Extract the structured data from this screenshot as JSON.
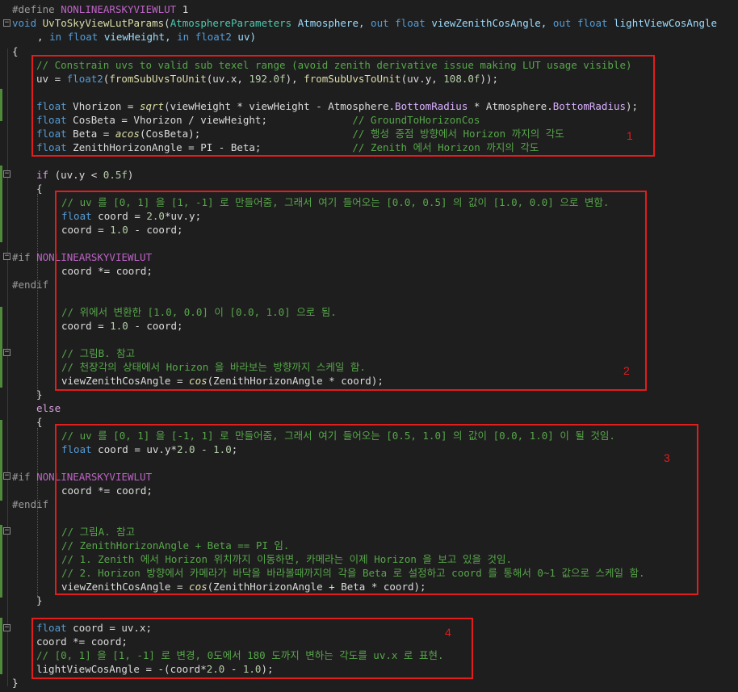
{
  "lines": {
    "l0": [
      "#define ",
      "NONLINEARSKYVIEWLUT",
      " 1"
    ],
    "l1": [
      "void ",
      "UvToSkyViewLutParams",
      "(",
      "AtmosphereParameters",
      " Atmosphere, ",
      "out",
      " ",
      "float",
      " viewZenithCosAngle, ",
      "out",
      " ",
      "float",
      " lightViewCosAngle"
    ],
    "l2": [
      ", ",
      "in",
      " ",
      "float",
      " viewHeight, ",
      "in",
      " ",
      "float2",
      " uv)"
    ],
    "l3": "{",
    "l4": "// Constrain uvs to valid sub texel range (avoid zenith derivative issue making LUT usage visible)",
    "l5": [
      "uv = ",
      "float2",
      "(",
      "fromSubUvsToUnit",
      "(uv.x, ",
      "192.0f",
      "), ",
      "fromSubUvsToUnit",
      "(uv.y, ",
      "108.0f",
      "));"
    ],
    "l7": [
      "float",
      " Vhorizon = ",
      "sqrt",
      "(viewHeight * viewHeight - Atmosphere.",
      "BottomRadius",
      " * Atmosphere.",
      "BottomRadius",
      ");"
    ],
    "l8": [
      "float",
      " CosBeta = Vhorizon / viewHeight;",
      "              // GroundToHorizonCos"
    ],
    "l9": [
      "float",
      " Beta = ",
      "acos",
      "(CosBeta);",
      "                         // 행성 중점 방향에서 Horizon 까지의 각도"
    ],
    "l10": [
      "float",
      " ZenithHorizonAngle = PI - Beta;",
      "               // Zenith 에서 Horizon 까지의 각도"
    ],
    "l12": [
      "if",
      " (uv.y < ",
      "0.5f",
      ")"
    ],
    "l13": "{",
    "l14": "// uv 를 [0, 1] 을 [1, -1] 로 만들어줌, 그래서 여기 들어오는 [0.0, 0.5] 의 값이 [1.0, 0.0] 으로 변함.",
    "l15": [
      "float",
      " coord = ",
      "2.0",
      "*uv.y;"
    ],
    "l16": [
      "coord = ",
      "1.0",
      " - coord;"
    ],
    "l18": [
      "#if ",
      "NONLINEARSKYVIEWLUT"
    ],
    "l19": "coord *= coord;",
    "l20": "#endif",
    "l22": "// 위에서 변환한 [1.0, 0.0] 이 [0.0, 1.0] 으로 됨.",
    "l23": [
      "coord = ",
      "1.0",
      " - coord;"
    ],
    "l25": "// 그림B. 참고",
    "l26": "// 천장각의 상태에서 Horizon 을 바라보는 방향까지 스케일 함.",
    "l27": [
      "viewZenithCosAngle = ",
      "cos",
      "(ZenithHorizonAngle * coord);"
    ],
    "l28": "}",
    "l29": "else",
    "l30": "{",
    "l31": "// uv 를 [0, 1] 을 [-1, 1] 로 만들어줌, 그래서 여기 들어오는 [0.5, 1.0] 의 값이 [0.0, 1.0] 이 될 것임.",
    "l32": [
      "float",
      " coord = uv.y*",
      "2.0",
      " - ",
      "1.0",
      ";"
    ],
    "l34": [
      "#if ",
      "NONLINEARSKYVIEWLUT"
    ],
    "l35": "coord *= coord;",
    "l36": "#endif",
    "l38": "// 그림A. 참고",
    "l39": "// ZenithHorizonAngle + Beta == PI 임.",
    "l40": "// 1. Zenith 에서 Horizon 위치까지 이동하면, 카메라는 이제 Horizon 을 보고 있을 것임.",
    "l41": "// 2. Horizon 방향에서 카메라가 바닥을 바라볼때까지의 각을 Beta 로 설정하고 coord 를 통해서 0~1 값으로 스케일 함.",
    "l42": [
      "viewZenithCosAngle = ",
      "cos",
      "(ZenithHorizonAngle + Beta * coord);"
    ],
    "l43": "}",
    "l45": [
      "float",
      " coord = uv.x;"
    ],
    "l46": "coord *= coord;",
    "l47": "// [0, 1] 을 [1, -1] 로 변경, 0도에서 180 도까지 변하는 각도를 uv.x 로 표현.",
    "l48": [
      "lightViewCosAngle = -(coord*",
      "2.0",
      " - ",
      "1.0",
      ");"
    ],
    "l49": "}"
  },
  "annotations": [
    "1",
    "2",
    "3",
    "4"
  ],
  "colors": {
    "box": "#e31c1c",
    "comment": "#57a64a",
    "keyword": "#569cd6",
    "macro": "#bd63c5"
  }
}
